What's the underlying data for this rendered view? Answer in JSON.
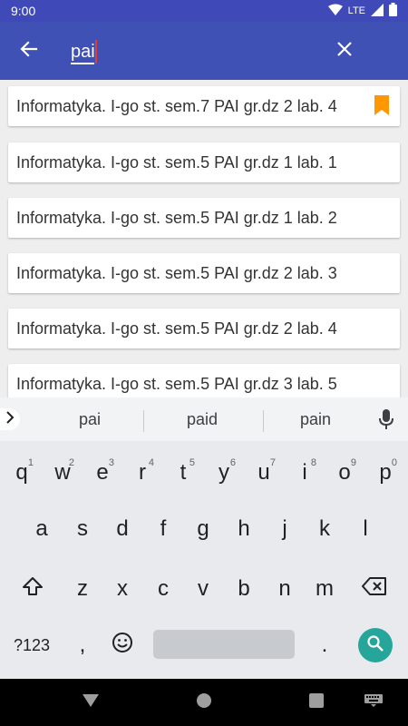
{
  "status_bar": {
    "time": "9:00",
    "network": "LTE"
  },
  "search": {
    "value": "pai",
    "placeholder": ""
  },
  "results": [
    {
      "label": "Informatyka. I-go st. sem.7 PAI gr.dz 2 lab. 4",
      "bookmarked": true
    },
    {
      "label": "Informatyka. I-go st. sem.5 PAI gr.dz 1 lab. 1",
      "bookmarked": false
    },
    {
      "label": "Informatyka. I-go st. sem.5 PAI gr.dz 1 lab. 2",
      "bookmarked": false
    },
    {
      "label": "Informatyka. I-go st. sem.5 PAI gr.dz 2 lab. 3",
      "bookmarked": false
    },
    {
      "label": "Informatyka. I-go st. sem.5 PAI gr.dz 2 lab. 4",
      "bookmarked": false
    },
    {
      "label": "Informatyka. I-go st. sem.5 PAI gr.dz 3 lab. 5",
      "bookmarked": false
    }
  ],
  "keyboard": {
    "suggestions": [
      "pai",
      "paid",
      "pain"
    ],
    "row1": [
      {
        "key": "q",
        "num": "1"
      },
      {
        "key": "w",
        "num": "2"
      },
      {
        "key": "e",
        "num": "3"
      },
      {
        "key": "r",
        "num": "4"
      },
      {
        "key": "t",
        "num": "5"
      },
      {
        "key": "y",
        "num": "6"
      },
      {
        "key": "u",
        "num": "7"
      },
      {
        "key": "i",
        "num": "8"
      },
      {
        "key": "o",
        "num": "9"
      },
      {
        "key": "p",
        "num": "0"
      }
    ],
    "row2": [
      "a",
      "s",
      "d",
      "f",
      "g",
      "h",
      "j",
      "k",
      "l"
    ],
    "row3": [
      "z",
      "x",
      "c",
      "v",
      "b",
      "n",
      "m"
    ],
    "symbols_label": "?123",
    "comma": ",",
    "period": "."
  },
  "colors": {
    "app_bar": "#3f51b5",
    "status_bar": "#3f49b8",
    "bookmark": "#ff9800",
    "enter_key": "#26a69a"
  },
  "icons": {
    "back": "arrow-left",
    "clear": "close",
    "bookmark": "bookmark",
    "mic": "microphone",
    "shift": "shift-arrow",
    "backspace": "backspace",
    "emoji": "smiley",
    "enter": "search",
    "nav_back": "triangle-back",
    "nav_home": "circle-home",
    "nav_recents": "square-recents",
    "nav_keyboard": "keyboard"
  }
}
